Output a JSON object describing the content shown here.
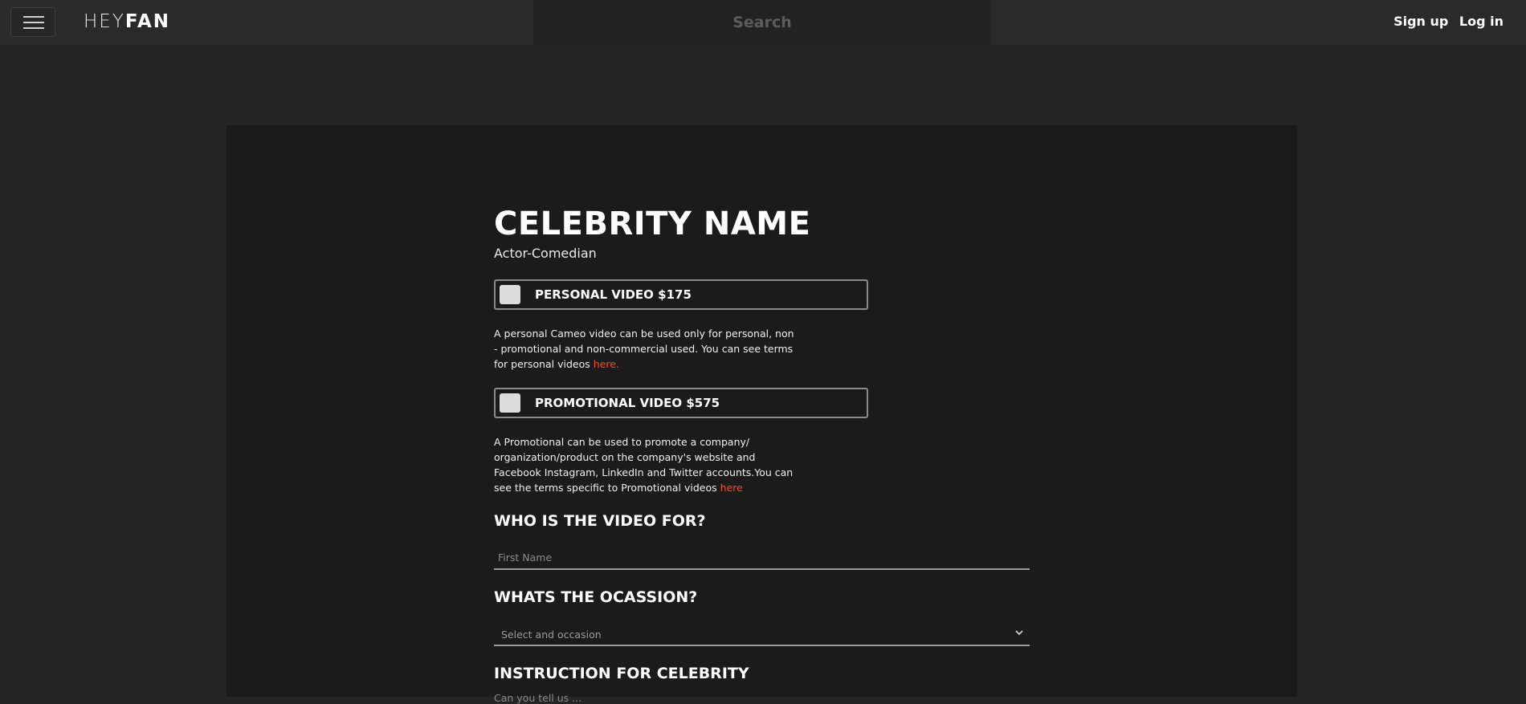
{
  "header": {
    "logo_light": "HEY",
    "logo_bold": "FAN",
    "search_placeholder": "Search",
    "signup_label": "Sign up",
    "login_label": "Log in"
  },
  "celebrity": {
    "name": "CELEBRITY NAME",
    "title": "Actor-Comedian"
  },
  "options": {
    "personal": {
      "label": "PERSONAL VIDEO $175",
      "description": "A personal Cameo video can be used only for personal, non - promotional and non-commercial used. You can see terms for personal videos ",
      "link_text": "here."
    },
    "promotional": {
      "label": "PROMOTIONAL VIDEO $575",
      "description": "A Promotional can be used to promote a company/ organization/product on the company's website and Facebook Instagram, LinkedIn and Twitter accounts.You can see the terms specific to Promotional videos ",
      "link_text": "here"
    }
  },
  "form": {
    "who_title": "WHO IS THE VIDEO FOR?",
    "first_name_placeholder": "First Name",
    "occasion_title": "WHATS THE OCASSION?",
    "occasion_placeholder": "Select and occasion",
    "instruction_title": "INSTRUCTION FOR CELEBRITY",
    "instruction_hint": "Can you tell us ... "
  },
  "colors": {
    "link": "#ff4a2b",
    "background": "#252525",
    "panel": "#1b1b1b"
  }
}
